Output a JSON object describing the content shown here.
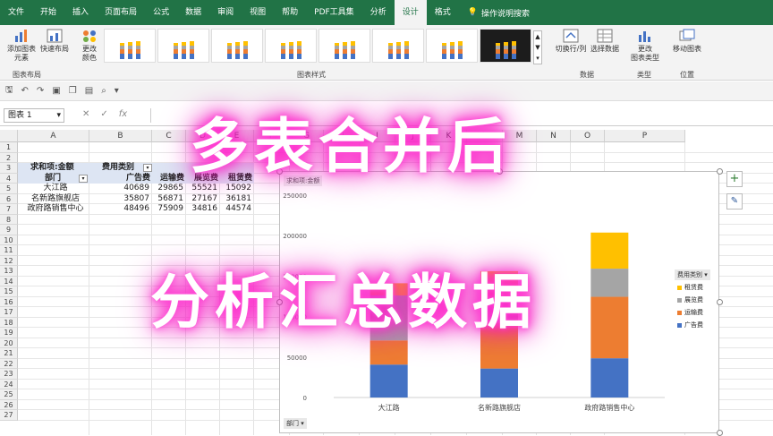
{
  "ribbon": {
    "tabs": [
      "文件",
      "开始",
      "插入",
      "页面布局",
      "公式",
      "数据",
      "审阅",
      "视图",
      "帮助",
      "PDF工具集",
      "分析",
      "设计",
      "格式"
    ],
    "active_tab": "设计",
    "tell_me": "操作说明搜索",
    "buttons": {
      "add_element": "添加图表\n元素",
      "quick_layout": "快速布局",
      "change_color": "更改\n颜色",
      "switch_row_col": "切换行/列",
      "select_data": "选择数据",
      "change_type": "更改\n图表类型",
      "move_chart": "移动图表"
    },
    "groups": {
      "layout": "图表布局",
      "styles": "图表样式",
      "data": "数据",
      "type": "类型",
      "location": "位置"
    }
  },
  "formula_bar": {
    "name_box": "图表 1",
    "fx": "fx"
  },
  "columns": [
    "A",
    "B",
    "C",
    "D",
    "E",
    "F",
    "G",
    "H",
    "I",
    "J",
    "K",
    "L",
    "M",
    "N",
    "O",
    "P"
  ],
  "rows": [
    "1",
    "2",
    "3",
    "4",
    "5",
    "6",
    "7",
    "8",
    "9",
    "10",
    "11",
    "12",
    "13",
    "14",
    "15",
    "16",
    "17",
    "18",
    "19",
    "20",
    "21",
    "22",
    "23",
    "24",
    "25",
    "26",
    "27"
  ],
  "pivot": {
    "value_label": "求和项:金额",
    "col_field": "费用类别",
    "row_field": "部门",
    "headers": [
      "广告费",
      "运输费",
      "展览费",
      "租赁费"
    ],
    "rows": [
      {
        "name": "大江路",
        "values": [
          "40689",
          "29865",
          "55521",
          "15092"
        ]
      },
      {
        "name": "名新路旗舰店",
        "values": [
          "35807",
          "56871",
          "27167",
          "36181"
        ]
      },
      {
        "name": "政府路销售中心",
        "values": [
          "48496",
          "75909",
          "34816",
          "44574"
        ]
      }
    ]
  },
  "chart_data": {
    "type": "bar",
    "stacked": true,
    "title": "",
    "value_field_button": "求和项:金额",
    "axis_field_button": "部门",
    "legend_field_button": "费用类别",
    "categories": [
      "大江路",
      "名新路旗舰店",
      "政府路销售中心"
    ],
    "series": [
      {
        "name": "广告费",
        "color": "#4472c4",
        "values": [
          40689,
          35807,
          48496
        ]
      },
      {
        "name": "运输费",
        "color": "#ed7d31",
        "values": [
          29865,
          56871,
          75909
        ]
      },
      {
        "name": "展览费",
        "color": "#a5a5a5",
        "values": [
          55521,
          27167,
          34816
        ]
      },
      {
        "name": "租赁费",
        "color": "#ffc000",
        "values": [
          15092,
          36181,
          44574
        ]
      }
    ],
    "yticks": [
      "0",
      "50000",
      "100000",
      "150000",
      "200000",
      "250000"
    ],
    "ylim": [
      0,
      250000
    ],
    "legend_position": "right",
    "grid": false
  },
  "overlay": {
    "line1": "多表合并后",
    "line2": "分析汇总数据"
  }
}
